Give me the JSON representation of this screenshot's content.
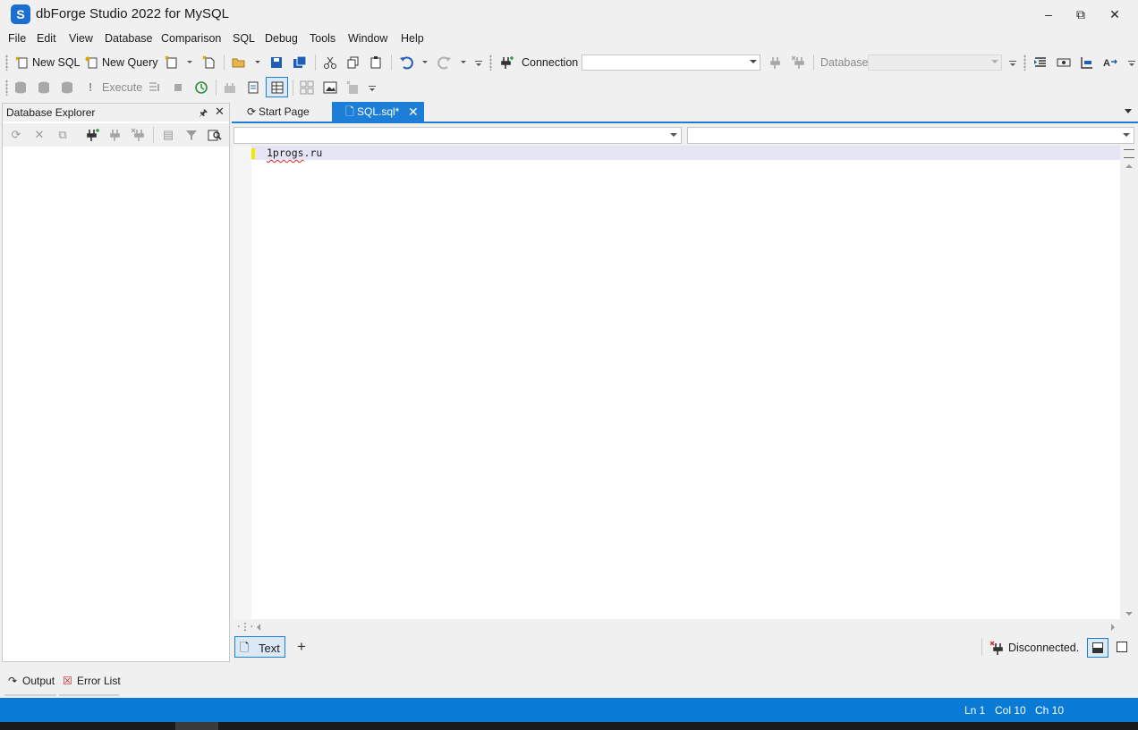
{
  "window": {
    "title": "dbForge Studio 2022 for MySQL",
    "app_icon_glyph": "S"
  },
  "menu": [
    "File",
    "Edit",
    "View",
    "Database",
    "Comparison",
    "SQL",
    "Debug",
    "Tools",
    "Window",
    "Help"
  ],
  "toolbar1": {
    "new_sql": "New SQL",
    "new_query": "New Query",
    "connection_label": "Connection",
    "connection_value": "",
    "database_label": "Database",
    "database_value": ""
  },
  "toolbar2": {
    "execute": "Execute"
  },
  "db_explorer": {
    "title": "Database Explorer"
  },
  "tabs": [
    {
      "label": "Start Page",
      "active": false
    },
    {
      "label": "SQL.sql*",
      "active": true
    }
  ],
  "editor": {
    "lines": [
      "1progs.ru"
    ],
    "misspelled": "1progs"
  },
  "view_bar": {
    "text_tab": "Text",
    "add": "+",
    "connection_status": "Disconnected."
  },
  "bottom_tabs": {
    "output": "Output",
    "error_list": "Error List"
  },
  "statusbar": {
    "ln": "Ln 1",
    "col": "Col 10",
    "ch": "Ch 10"
  },
  "colors": {
    "accent": "#1c7ed6",
    "statusbar": "#0a7ad7",
    "line_highlight": "#e5e5f6",
    "change_marker": "#f5e800"
  }
}
